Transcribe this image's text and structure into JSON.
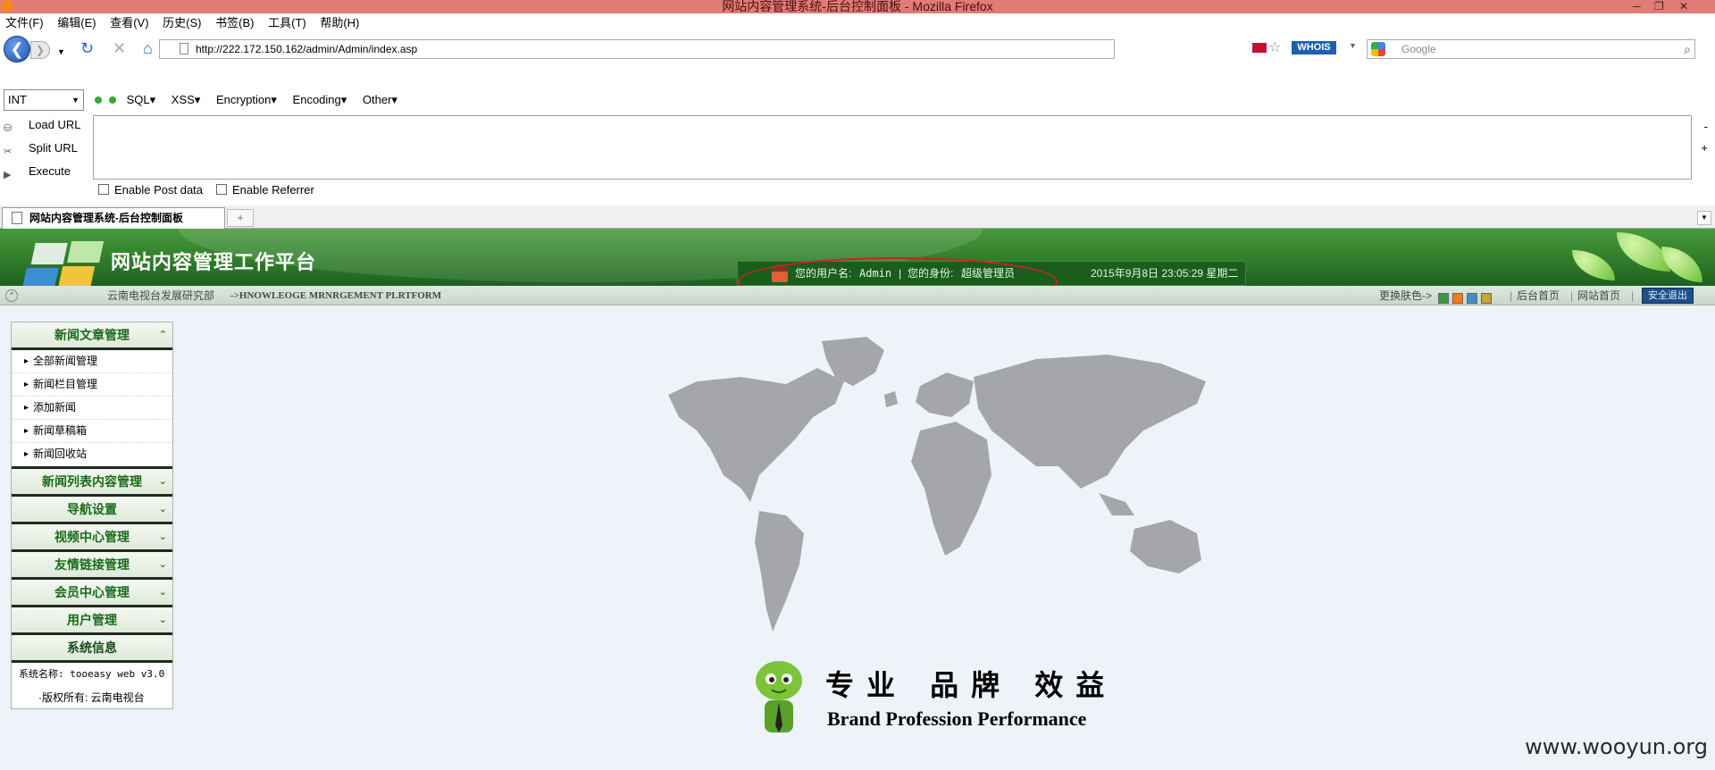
{
  "window": {
    "title": "网站内容管理系统-后台控制面板 - Mozilla Firefox"
  },
  "menubar": {
    "items": [
      "文件(F)",
      "编辑(E)",
      "查看(V)",
      "历史(S)",
      "书签(B)",
      "工具(T)",
      "帮助(H)"
    ]
  },
  "nav": {
    "url": "http://222.172.150.162/admin/Admin/index.asp",
    "whois": "WHOIS",
    "search_placeholder": "Google"
  },
  "hackbar": {
    "select": "INT",
    "menus": [
      "SQL▾",
      "XSS▾",
      "Encryption▾",
      "Encoding▾",
      "Other▾"
    ],
    "buttons": [
      "Load URL",
      "Split URL",
      "Execute"
    ],
    "checkboxes": [
      "Enable Post data",
      "Enable Referrer"
    ],
    "side_minus": "-",
    "side_plus": "+"
  },
  "tabs": {
    "active": "网站内容管理系统-后台控制面板",
    "new_tab": "+"
  },
  "header": {
    "title": "网站内容管理工作平台",
    "user_label": "您的用户名:",
    "username": "Admin",
    "role_label": "您的身份:",
    "role": "超级管理员",
    "datetime": "2015年9月8日 23:05:29 星期二"
  },
  "subbar": {
    "org": "云南电视台发展研究部",
    "tagline": "->HNOWLEOGE MRNRGEMENT PLRTFORM",
    "skin_label": "更换肤色->",
    "skin_colors": [
      "#3a9a3a",
      "#f07c12",
      "#3a8fd0",
      "#c8a23a"
    ],
    "home_link": "后台首页",
    "site_link": "网站首页",
    "logout": "安全退出"
  },
  "sidebar": {
    "news_section": "新闻文章管理",
    "news_items": [
      "全部新闻管理",
      "新闻栏目管理",
      "添加新闻",
      "新闻草稿箱",
      "新闻回收站"
    ],
    "sections": [
      "新闻列表内容管理",
      "导航设置",
      "视频中心管理",
      "友情链接管理",
      "会员中心管理",
      "用户管理"
    ],
    "sysinfo_title": "系统信息",
    "sys_name": "系统名称: tooeasy web v3.0",
    "copyright": "·版权所有:  云南电视台"
  },
  "slogan": {
    "cn": "专业 品牌 效益",
    "en": "Brand Profession Performance"
  },
  "watermark": "www.wooyun.org"
}
